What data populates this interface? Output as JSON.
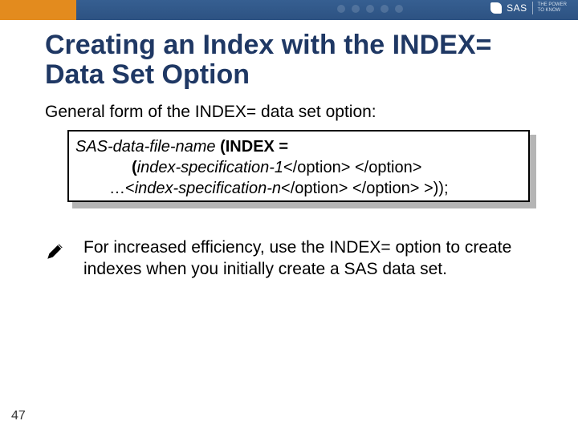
{
  "brand": {
    "sas": "SAS",
    "tagline1": "THE POWER",
    "tagline2": "TO KNOW"
  },
  "title": "Creating an Index with the INDEX= Data Set Option",
  "subtitle": "General form of the INDEX= data set option:",
  "code": {
    "line1_it": "SAS-data-file-name",
    "line1_b": " (INDEX =",
    "line2_a": "(",
    "line2_it": "index-specification-1",
    "line2_b": "</option> </option>",
    "line3_a": "…<",
    "line3_it": "index-specification-n",
    "line3_b": "</option> </option> >));"
  },
  "note": "For increased efficiency, use the INDEX= option to create indexes when you initially create a SAS data set.",
  "page_number": "47"
}
